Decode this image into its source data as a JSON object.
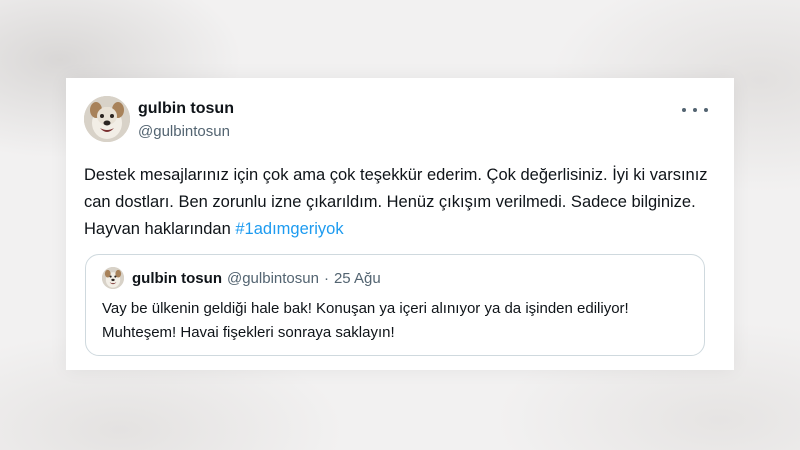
{
  "tweet": {
    "author_name": "gulbin tosun",
    "author_handle": "@gulbintosun",
    "text_main": "Destek mesajlarınız için çok ama çok teşekkür ederim. Çok değerlisiniz. İyi ki varsınız can dostları. Ben zorunlu izne çıkarıldım. Henüz çıkışım verilmedi. Sadece bilginize. Hayvan haklarından ",
    "hashtag": "#1adımgeriyok",
    "more_icon": "more-horizontal-icon"
  },
  "quoted_tweet": {
    "author_name": "gulbin tosun",
    "author_handle": "@gulbintosun",
    "separator": "·",
    "date": "25 Ağu",
    "text": "Vay be ülkenin geldiği hale bak! Konuşan ya içeri alınıyor ya da işinden ediliyor! Muhteşem! Havai fişekleri sonraya saklayın!"
  },
  "colors": {
    "text_primary": "#0f1419",
    "text_secondary": "#536471",
    "link": "#1d9bf0",
    "border": "#cfd9de"
  }
}
